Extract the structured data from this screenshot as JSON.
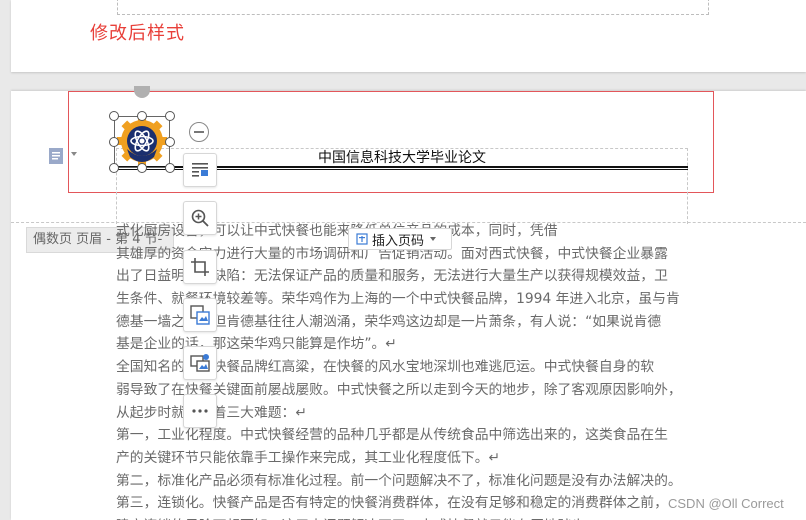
{
  "caption": "修改后样式",
  "header": {
    "title": "中国信息科技大学毕业论文"
  },
  "footer": {
    "label": "偶数页 页眉 - 第 4 节-",
    "insert_page_number": "插入页码"
  },
  "body_lines": [
    "式化厨房设备，可以让中式快餐也能来降低单位产品的成本，同时，凭借",
    "其雄厚的资金实力进行大量的市场调研和广告促销活动。面对西式快餐，中式快餐企业暴露",
    "出了日益明显的缺陷：无法保证产品的质量和服务，无法进行大量生产以获得规模效益，卫",
    "生条件、就餐环境较差等。荣华鸡作为上海的一个中式快餐品牌，1994 年进入北京，虽与肯",
    "德基一墙之隔，但肯德基往往人潮汹涌，荣华鸡这边却是一片萧条，有人说：“如果说肯德",
    "基是企业的话，那这荣华鸡只能算是作坊”。↵",
    "全国知名的中式快餐品牌红高粱，在快餐的风水宝地深圳也难逃厄运。中式快餐自身的软",
    "弱导致了在快餐关键面前屡战屡败。中式快餐之所以走到今天的地步，除了客观原因影响外，",
    "从起步时就面临着三大难题：↵",
    "第一，工业化程度。中式快餐经营的品种几乎都是从传统食品中筛选出来的，这类食品在生",
    "产的关键环节只能依靠手工操作来完成，其工业化程度低下。↵",
    "第二，标准化产品必须有标准化过程。前一个问题解决不了，标准化问题是没有办法解决的。↵",
    "第三，连锁化。快餐产品是否有特定的快餐消费群体，在没有足够和稳定的消费群体之前，",
    "建立连锁的风险可想而知。这三大问题解决不了，中式快餐就只能在原地踏步。↵"
  ],
  "watermark": "CSDN @Oll Correct",
  "colors": {
    "caption_red": "#e8403a",
    "header_border": "#e3565a",
    "logo_orange": "#f0a020",
    "logo_navy": "#1b2f6e"
  },
  "icons": [
    "document-icon",
    "wrap-text-icon",
    "zoom-in-icon",
    "crop-icon",
    "image-convert-icon",
    "replace-image-icon",
    "more-icon"
  ]
}
